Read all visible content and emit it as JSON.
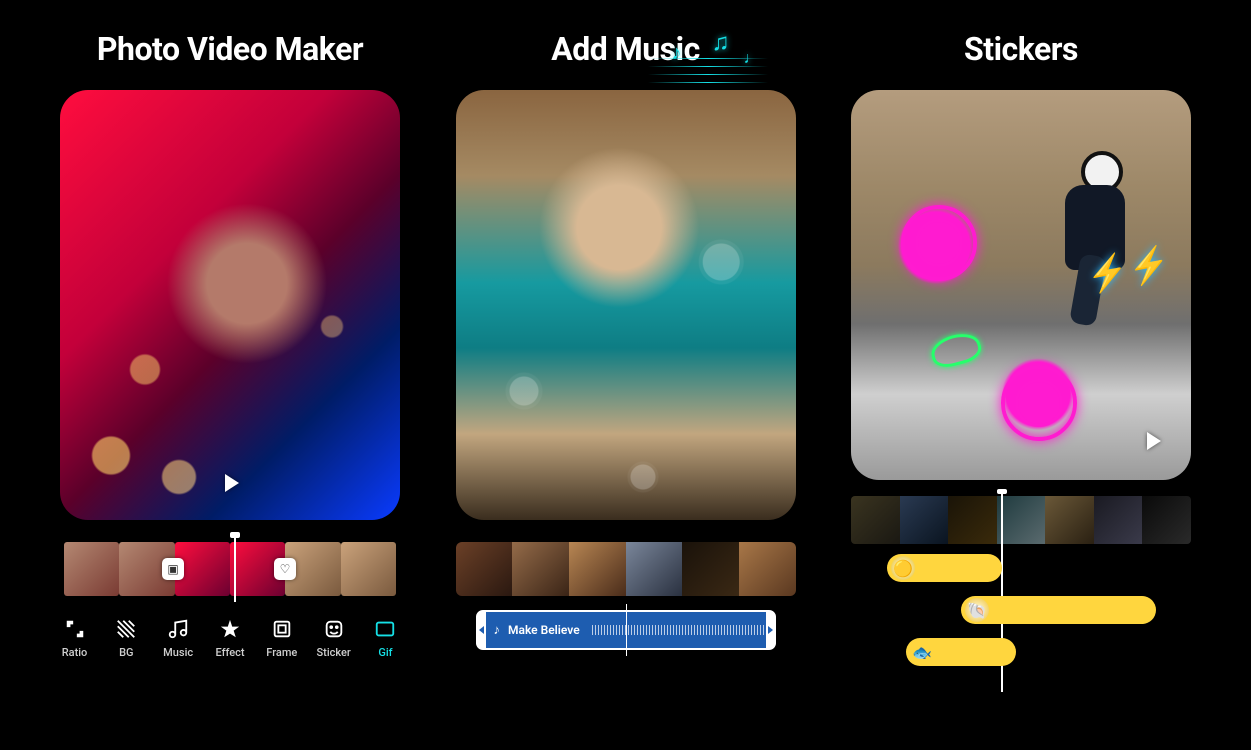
{
  "panels": [
    {
      "title": "Photo Video Maker"
    },
    {
      "title": "Add Music"
    },
    {
      "title": "Stickers"
    }
  ],
  "panel1": {
    "tools": [
      {
        "label": "Ratio",
        "icon": "ratio-icon"
      },
      {
        "label": "BG",
        "icon": "bg-icon"
      },
      {
        "label": "Music",
        "icon": "music-icon"
      },
      {
        "label": "Effect",
        "icon": "effect-icon"
      },
      {
        "label": "Frame",
        "icon": "frame-icon"
      },
      {
        "label": "Sticker",
        "icon": "sticker-icon"
      },
      {
        "label": "Gif",
        "icon": "gif-icon"
      }
    ],
    "transition_icons": [
      "▣",
      "♡"
    ]
  },
  "panel2": {
    "music_clip": {
      "title": "Make Believe"
    }
  },
  "colors": {
    "accent": "#15e0e6",
    "neon_pink": "#ff1bd0",
    "music_bar": "#1e5db0",
    "sticker_track": "#ffd63e"
  }
}
